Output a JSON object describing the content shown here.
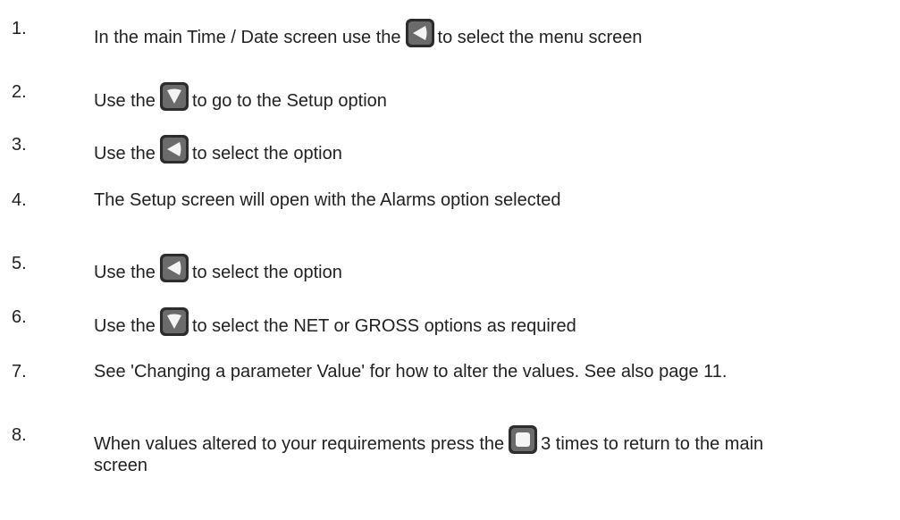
{
  "steps": [
    {
      "num": "1.",
      "before": "In the main Time / Date screen use the",
      "icon": "left-arrow-button-icon",
      "after": "to select the menu screen"
    },
    {
      "num": "2.",
      "before": "Use the",
      "icon": "down-arrow-button-icon",
      "after": "to go to the Setup option"
    },
    {
      "num": "3.",
      "before": "Use the",
      "icon": "left-arrow-button-icon",
      "after": "to select the option"
    },
    {
      "num": "4.",
      "text": "The Setup screen will open with the Alarms option selected"
    },
    {
      "num": "5.",
      "before": "Use the",
      "icon": "left-arrow-button-icon",
      "after": "to select the option"
    },
    {
      "num": "6.",
      "before": "Use the",
      "icon": "down-arrow-button-icon",
      "after": "to select the NET or GROSS options as required"
    },
    {
      "num": "7.",
      "text": "See 'Changing a parameter Value' for how to alter the values. See also page 11."
    },
    {
      "num": "8.",
      "before": "When values altered to your requirements press the",
      "icon": "square-button-icon",
      "after": "3 times to return to the main screen"
    }
  ]
}
